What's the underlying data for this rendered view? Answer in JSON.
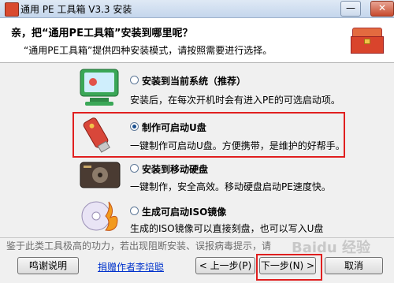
{
  "window": {
    "title": "通用 PE 工具箱 V3.3 安装"
  },
  "header": {
    "heading": "亲，把“通用PE工具箱”安装到哪里呢？",
    "subheading": "“通用PE工具箱”提供四种安装模式，请按照需要进行选择。"
  },
  "options": [
    {
      "label": "安装到当前系统（推荐）",
      "desc": "安装后，在每次开机时会有进入PE的可选启动项。",
      "selected": false
    },
    {
      "label": "制作可启动U盘",
      "desc": "一键制作可启动U盘。方便携带，是维护的好帮手。",
      "selected": true
    },
    {
      "label": "安装到移动硬盘",
      "desc": "一键制作，安全高效。移动硬盘启动PE速度快。",
      "selected": false
    },
    {
      "label": "生成可启动ISO镜像",
      "desc": "生成的ISO镜像可以直接刻盘，也可以写入U盘",
      "selected": false
    }
  ],
  "footer": {
    "notice": "鉴于此类工具极高的功力，若出现阻断安装、误报病毒提示，请",
    "thanks_button": "鸣谢说明",
    "donate_link": "捐赠作者李培聪",
    "prev_button": "< 上一步(P)",
    "next_button": "下一步(N) >",
    "cancel_button": "取消"
  },
  "watermark": "Baidu 经验"
}
